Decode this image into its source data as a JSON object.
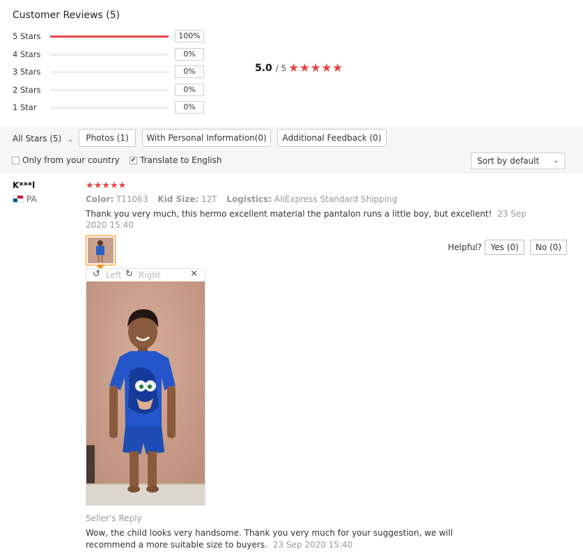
{
  "summary": {
    "title": "Customer Reviews (5)",
    "rows": [
      {
        "label": "5 Stars",
        "percent_text": "100%",
        "fraction": 1.0
      },
      {
        "label": "4 Stars",
        "percent_text": "0%",
        "fraction": 0.0
      },
      {
        "label": "3 Stars",
        "percent_text": "0%",
        "fraction": 0.0
      },
      {
        "label": "2 Stars",
        "percent_text": "0%",
        "fraction": 0.0
      },
      {
        "label": "1 Star",
        "percent_text": "0%",
        "fraction": 0.0
      }
    ],
    "average": "5.0",
    "out_of": "/ 5",
    "stars": "★★★★★"
  },
  "filters": {
    "all_stars": "All Stars (5)",
    "photos": "Photos (1)",
    "personal_info": "With Personal Information(0)",
    "additional_feedback": "Additional Feedback (0)",
    "only_country": "Only from your country",
    "translate": "Translate to English",
    "sort": "Sort by default"
  },
  "review": {
    "user": "K***l",
    "country": "PA",
    "stars": "★★★★★",
    "color_label": "Color:",
    "color_value": "T11063",
    "size_label": "Kid Size:",
    "size_value": "12T",
    "logistics_label": "Logistics:",
    "logistics_value": "AliExpress Standard Shipping",
    "text": "Thank you very much, this hermo excellent material the pantalon runs a little boy, but excellent!",
    "date": "23 Sep 2020 15:40",
    "helpful_label": "Helpful?",
    "yes": "Yes (0)",
    "no": "No (0)",
    "viewer": {
      "left": "Left",
      "right": "Right"
    },
    "seller_reply_title": "Seller's Reply",
    "seller_reply_text": "Wow, the child looks very handsome. Thank you very much for your suggestion, we will recommend a more suitable size to buyers.",
    "seller_reply_date": "23 Sep 2020 15:40"
  },
  "colors": {
    "accent": "#e64545",
    "thumb_border": "#ff8a00"
  },
  "icons": [
    "chevron-down-icon",
    "rotate-left-icon",
    "rotate-right-icon",
    "close-icon",
    "panama-flag-icon"
  ]
}
